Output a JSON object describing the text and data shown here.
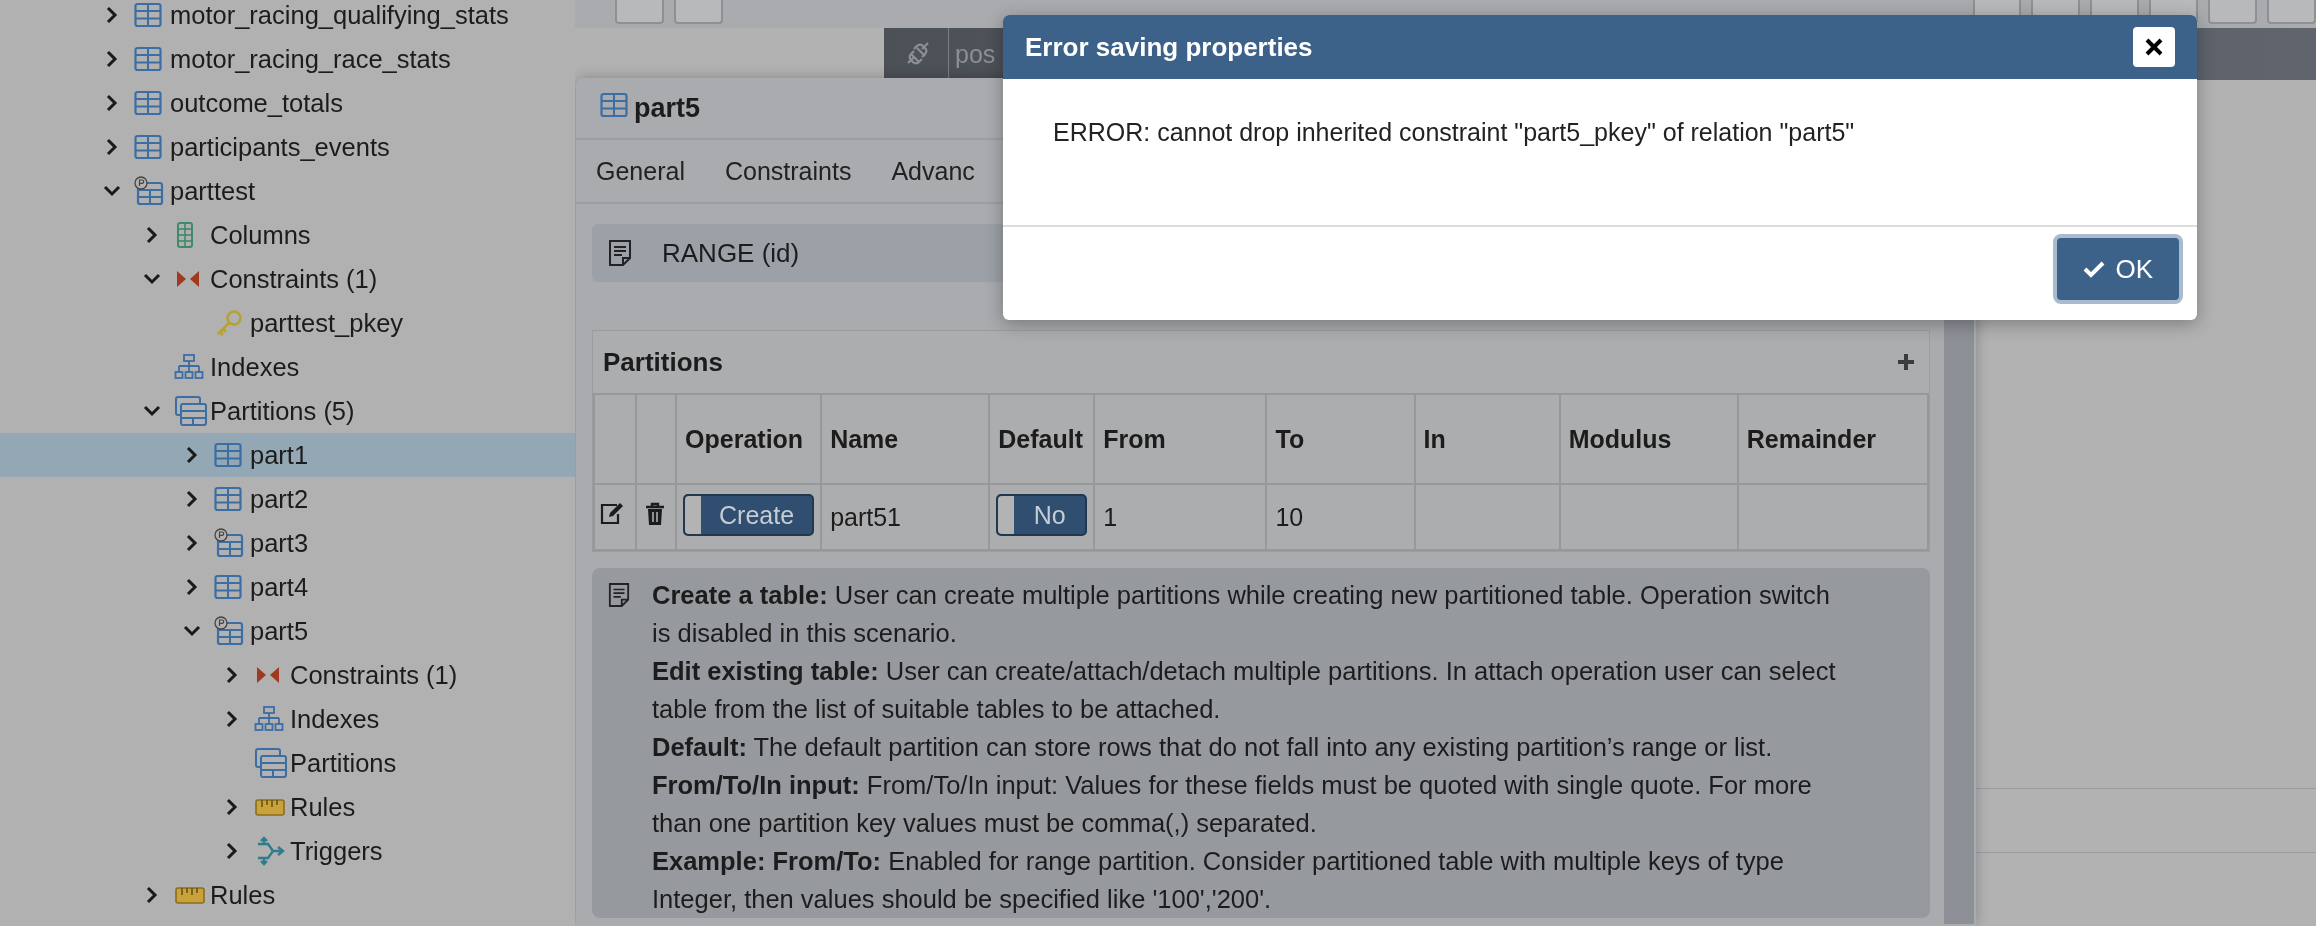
{
  "browser_tree": [
    {
      "label": "motor_racing_qualifying_stats",
      "kind": "table",
      "expanded": false,
      "selected": false
    },
    {
      "label": "motor_racing_race_stats",
      "kind": "table",
      "expanded": false,
      "selected": false
    },
    {
      "label": "outcome_totals",
      "kind": "table",
      "expanded": false,
      "selected": false
    },
    {
      "label": "participants_events",
      "kind": "table",
      "expanded": false,
      "selected": false
    },
    {
      "label": "parttest",
      "kind": "partitioned-table",
      "expanded": true,
      "selected": false,
      "children": [
        {
          "label": "Columns",
          "kind": "columns",
          "expanded": false,
          "selected": false
        },
        {
          "label": "Constraints (1)",
          "kind": "constraints",
          "expanded": true,
          "selected": false,
          "children": [
            {
              "label": "parttest_pkey",
              "kind": "key",
              "selected": false
            }
          ]
        },
        {
          "label": "Indexes",
          "kind": "indexes",
          "selected": false
        },
        {
          "label": "Partitions (5)",
          "kind": "partitions",
          "expanded": true,
          "selected": false,
          "children": [
            {
              "label": "part1",
              "kind": "table",
              "expanded": false,
              "selected": true
            },
            {
              "label": "part2",
              "kind": "table",
              "expanded": false,
              "selected": false
            },
            {
              "label": "part3",
              "kind": "partitioned-table",
              "expanded": false,
              "selected": false
            },
            {
              "label": "part4",
              "kind": "table",
              "expanded": false,
              "selected": false
            },
            {
              "label": "part5",
              "kind": "partitioned-table",
              "expanded": true,
              "selected": false,
              "children": [
                {
                  "label": "Constraints (1)",
                  "kind": "constraints",
                  "expanded": false,
                  "selected": false
                },
                {
                  "label": "Indexes",
                  "kind": "indexes",
                  "expanded": false,
                  "selected": false
                },
                {
                  "label": "Partitions",
                  "kind": "partitions",
                  "selected": false
                },
                {
                  "label": "Rules",
                  "kind": "rules",
                  "expanded": false,
                  "selected": false
                },
                {
                  "label": "Triggers",
                  "kind": "triggers",
                  "expanded": false,
                  "selected": false
                }
              ]
            }
          ]
        },
        {
          "label": "Rules",
          "kind": "rules",
          "expanded": false,
          "selected": false
        }
      ]
    }
  ],
  "connection_bar": {
    "text": "pos"
  },
  "properties_dialog": {
    "title": "part5",
    "tabs": [
      {
        "label": "General",
        "selected": false
      },
      {
        "label": "Constraints",
        "selected": false
      },
      {
        "label": "Advanc",
        "selected": false
      }
    ],
    "partition_key": "RANGE (id)",
    "partitions": {
      "title": "Partitions",
      "columns": [
        "Operation",
        "Name",
        "Default",
        "From",
        "To",
        "In",
        "Modulus",
        "Remainder"
      ],
      "rows": [
        {
          "cells": [
            {
              "kind": "toggle",
              "text": "Create",
              "on": false
            },
            {
              "kind": "text",
              "text": "part51"
            },
            {
              "kind": "toggle",
              "text": "No",
              "on": false
            },
            {
              "kind": "text",
              "text": "1"
            },
            {
              "kind": "text",
              "text": "10"
            },
            {
              "kind": "empty"
            },
            {
              "kind": "empty"
            },
            {
              "kind": "empty"
            }
          ]
        }
      ]
    },
    "help": [
      "**Create a table:** User can create multiple partitions while creating new partitioned table. Operation switch is disabled in this scenario.",
      "**Edit existing table:** User can create/attach/detach multiple partitions. In attach operation user can select table from the list of suitable tables to be attached.",
      "**Default:** The default partition can store rows that do not fall into any existing partition’s range or list.",
      "**From/To/In input:** From/To/In input: Values for these fields must be quoted with single quote. For more than one partition key values must be comma(,) separated.",
      "**Example: From/To:** Enabled for range partition. Consider partitioned table with multiple keys of type Integer, then values should be specified like '100','200'."
    ]
  },
  "error_dialog": {
    "title": "Error saving properties",
    "message": "ERROR: cannot drop inherited constraint \"part5_pkey\" of relation \"part5\"",
    "ok_button": "OK"
  }
}
